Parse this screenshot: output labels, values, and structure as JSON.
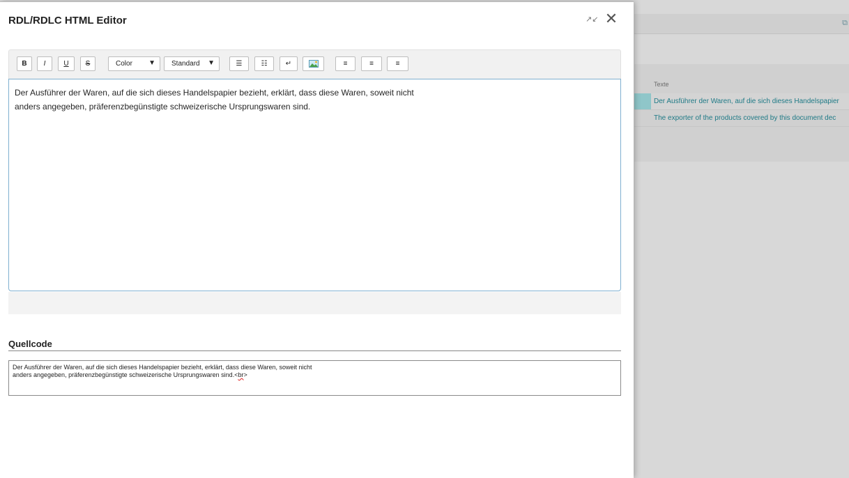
{
  "dialog": {
    "title": "RDL/RDLC HTML Editor",
    "shrink_icon": "↗↙",
    "close_icon": "✕"
  },
  "toolbar": {
    "bold": "B",
    "italic": "I",
    "underline": "U",
    "strike": "S",
    "color_select": "Color",
    "style_select": "Standard",
    "chevron": "▼",
    "bullet_list_icon": "☰",
    "numbered_list_icon": "☷",
    "line_break_icon": "↵",
    "image_icon": "🖼",
    "align_left_icon": "≡",
    "align_center_icon": "≡",
    "align_right_icon": "≡"
  },
  "editor": {
    "line1": "Der Ausführer der Waren, auf die sich dieses Handelspapier bezieht, erklärt, dass diese Waren, soweit nicht",
    "line2": "anders angegeben, präferenzbegünstigte schweizerische Ursprungswaren sind."
  },
  "source": {
    "label": "Quellcode",
    "line1": "Der Ausführer der Waren, auf die sich dieses Handelspapier bezieht, erklärt, dass diese Waren, soweit nicht",
    "line2_prefix": "anders angegeben, präferenzbegünstigte schweizerische Ursprungswaren sind.<",
    "line2_tag": "br",
    "line2_suffix": ">"
  },
  "background": {
    "column_header": "Texte",
    "row1": "Der Ausführer der Waren, auf die sich dieses Handelspapier",
    "row2": "The exporter of the products covered by this document dec",
    "edit_icon": "⧉"
  },
  "colors": {
    "accent_teal": "#1f7a86",
    "editor_focus_border": "#7fb0d0"
  }
}
